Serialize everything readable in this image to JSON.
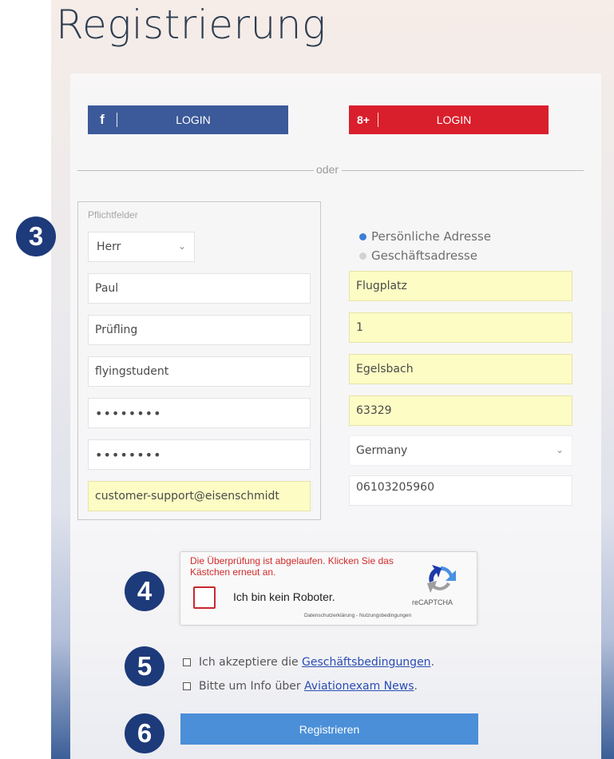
{
  "page": {
    "title": "Registrierung"
  },
  "social": {
    "facebook": {
      "icon": "f",
      "label": "LOGIN",
      "color": "#3c5a99"
    },
    "google": {
      "icon": "8+",
      "label": "LOGIN",
      "color": "#da1f2c"
    }
  },
  "separator": {
    "text": "oder"
  },
  "form": {
    "required_legend": "Pflichtfelder",
    "salutation": {
      "value": "Herr"
    },
    "first_name": {
      "value": "Paul"
    },
    "last_name": {
      "value": "Prüfling"
    },
    "username": {
      "value": "flyingstudent"
    },
    "password": {
      "value": "••••••••"
    },
    "password_confirm": {
      "value": "••••••••"
    },
    "email": {
      "value": "customer-support@eisenschmidt"
    },
    "address_type": {
      "options": [
        {
          "label": "Persönliche Adresse",
          "selected": true
        },
        {
          "label": "Geschäftsadresse",
          "selected": false
        }
      ]
    },
    "street": {
      "value": "Flugplatz"
    },
    "house_number": {
      "value": "1"
    },
    "city": {
      "value": "Egelsbach"
    },
    "zip": {
      "value": "63329"
    },
    "country": {
      "value": "Germany"
    },
    "phone": {
      "value": "06103205960"
    }
  },
  "captcha": {
    "error": "Die Überprüfung ist abgelaufen. Klicken Sie das Kästchen erneut an.",
    "label": "Ich bin kein Roboter.",
    "brand": "reCAPTCHA",
    "links": "Datenschutzerklärung - Nutzungsbedingungen"
  },
  "terms": {
    "prefix": "Ich akzeptiere die ",
    "link": "Geschäftsbedingungen",
    "suffix": "."
  },
  "newsletter": {
    "prefix": "Bitte um Info über ",
    "link": "Aviationexam News",
    "suffix": "."
  },
  "submit_label": "Registrieren",
  "badges": [
    "3",
    "4",
    "5",
    "6"
  ]
}
